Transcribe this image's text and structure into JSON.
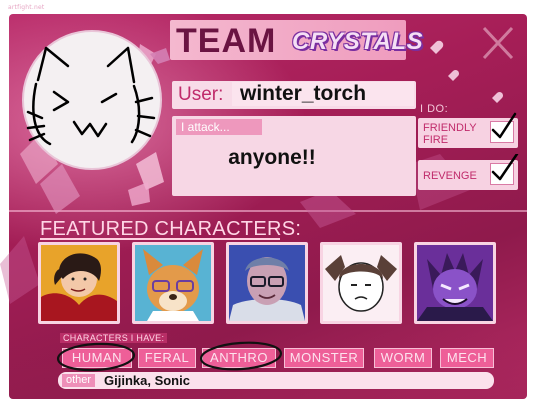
{
  "watermark": "artfight.net",
  "header": {
    "team_word": "TEAM",
    "team_name": "CRYSTALS"
  },
  "profile": {
    "user_label": "User:",
    "username": "winter_torch",
    "attack_label": "I attack...",
    "attack_value": "anyone!!"
  },
  "i_do": {
    "label": "I DO:",
    "options": [
      {
        "label_line1": "FRIENDLY",
        "label_line2": "FIRE",
        "checked": true
      },
      {
        "label_line1": "REVENGE",
        "label_line2": "",
        "checked": true
      }
    ]
  },
  "featured": {
    "label": "FEATURED CHARACTERS:",
    "characters": [
      {
        "name": "character-1",
        "bg": "#e8a32a"
      },
      {
        "name": "character-2",
        "bg": "#58b3d3"
      },
      {
        "name": "character-3",
        "bg": "#3a4fb0"
      },
      {
        "name": "character-4",
        "bg": "#fbeef3"
      },
      {
        "name": "character-5",
        "bg": "#6a2f9a"
      }
    ]
  },
  "characters_have": {
    "label": "CHARACTERS I HAVE:",
    "tags": [
      {
        "label": "HUMAN",
        "circled": true
      },
      {
        "label": "FERAL",
        "circled": false
      },
      {
        "label": "ANTHRO",
        "circled": true
      },
      {
        "label": "MONSTER",
        "circled": false
      },
      {
        "label": "WORM",
        "circled": false
      },
      {
        "label": "MECH",
        "circled": false
      }
    ],
    "other_label": "other",
    "other_value": "Gijinka, Sonic"
  },
  "colors": {
    "panel": "#a61e57",
    "accent": "#ee5f98",
    "light": "#f8dbe8"
  }
}
